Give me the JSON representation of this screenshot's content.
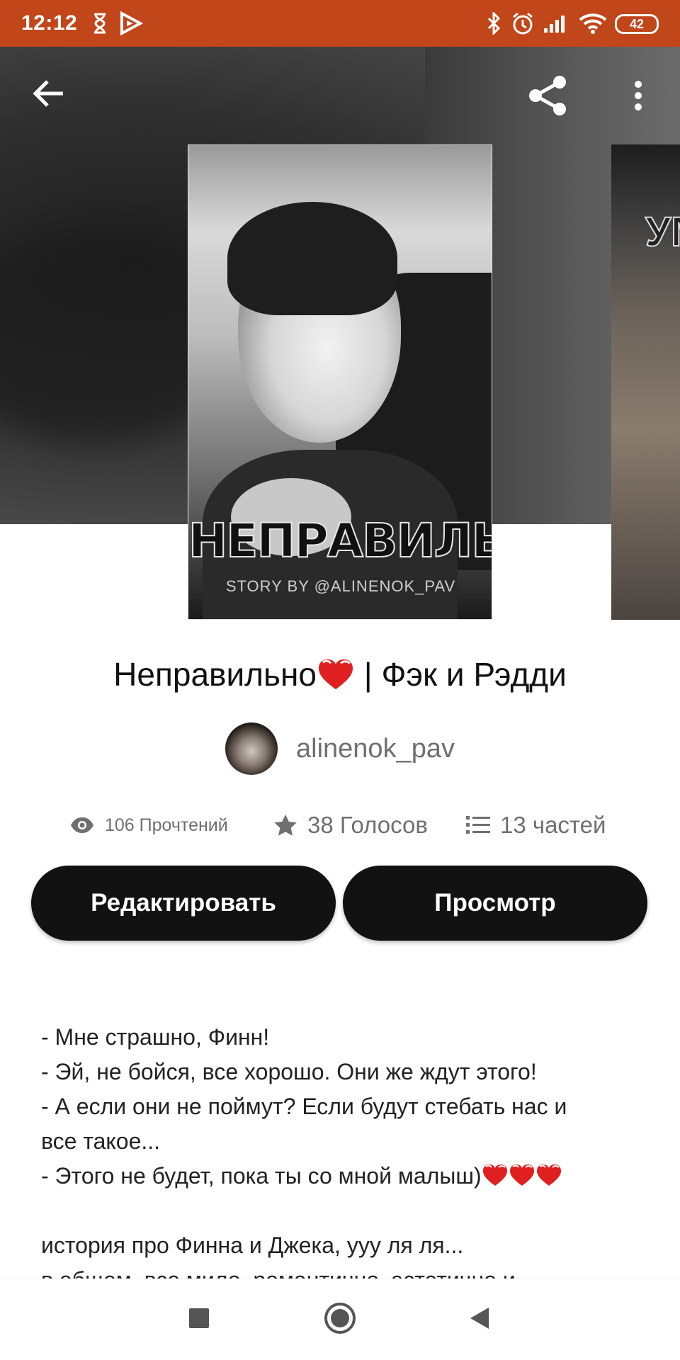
{
  "status_bar": {
    "time": "12:12",
    "battery": "42",
    "icons": [
      "hourglass-icon",
      "play-icon",
      "bluetooth-icon",
      "alarm-icon",
      "signal-icon",
      "wifi-icon",
      "battery-icon"
    ]
  },
  "toolbar": {
    "back_icon": "arrow-left-icon",
    "share_icon": "share-icon",
    "more_icon": "more-vertical-icon"
  },
  "cover": {
    "title_text": "НЕПРАВИЛЬНО",
    "subtitle_text": "STORY BY @ALINENOK_PAV",
    "next_cover_text": "УМ"
  },
  "story": {
    "title": "Неправильно",
    "title_suffix": "| Фэк и Рэдди",
    "author": "alinenok_pav"
  },
  "stats": {
    "reads": "106 Прочтений",
    "votes": "38 Голосов",
    "parts": "13 частей"
  },
  "actions": {
    "edit_label": "Редактировать",
    "preview_label": "Просмотр"
  },
  "description": {
    "line1": "- Мне страшно, Финн!",
    "line2": "- Эй, не бойся, все хорошо. Они же ждут этого!",
    "line3": "- А если они не поймут? Если будут стебать нас и",
    "line4": "все такое...",
    "line5": "- Этого не будет, пока ты со мной малыш)",
    "line6": "история про Финна и Джека, ууу ля ля...",
    "line7": "в общем, все мило, романтично, эстетично и"
  },
  "colors": {
    "status_bar": "#c1461a",
    "button_bg": "#121212",
    "heart": "#e02020"
  },
  "nav": {
    "recents_icon": "square-icon",
    "home_icon": "circle-icon",
    "back_icon": "triangle-back-icon"
  }
}
